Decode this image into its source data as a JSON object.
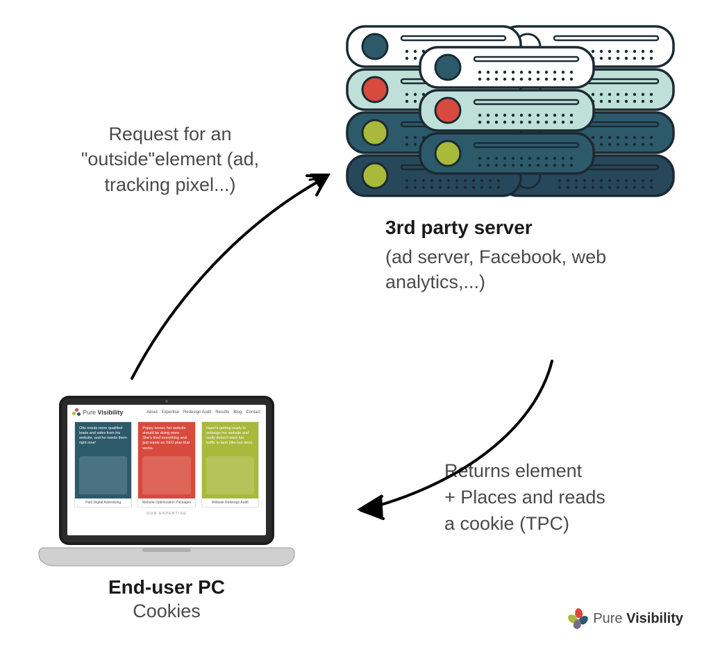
{
  "diagram": {
    "request_label": "Request for an \"outside\"element (ad, tracking pixel...)",
    "server": {
      "title": "3rd party server",
      "subtitle": "(ad server, Facebook, web analytics,...)"
    },
    "return_label": "Returns element\n+ Places and reads\na cookie (TPC)",
    "enduser": {
      "title": "End-user PC",
      "subtitle": "Cookies"
    }
  },
  "website_mock": {
    "brand_pure": "Pure",
    "brand_vis": "Visibility",
    "nav": [
      "About",
      "Expertise",
      "Redesign Audit",
      "Results",
      "Blog",
      "Contact"
    ],
    "cards": [
      {
        "blurb": "Otis needs more qualified leads and sales from his website, and he needs them right now!",
        "caption": "Paid Digital Advertising"
      },
      {
        "blurb": "Poppy knows her website should be doing more. She's tried everything and just wants an SEO plan that works.",
        "caption": "Website Optimization Packages"
      },
      {
        "blurb": "Hazel's getting ready to redesign her website and really doesn't want her traffic to tank (like last time).",
        "caption": "Website Redesign Audit"
      }
    ],
    "section_heading": "OUR EXPERTISE"
  },
  "footer": {
    "brand_pure": "Pure",
    "brand_vis": "Visibility"
  },
  "palette": {
    "teal_dark": "#2c5a6b",
    "teal_mint": "#bfe0d8",
    "red": "#d84a3d",
    "olive": "#a8b93c",
    "navy": "#27485a"
  }
}
